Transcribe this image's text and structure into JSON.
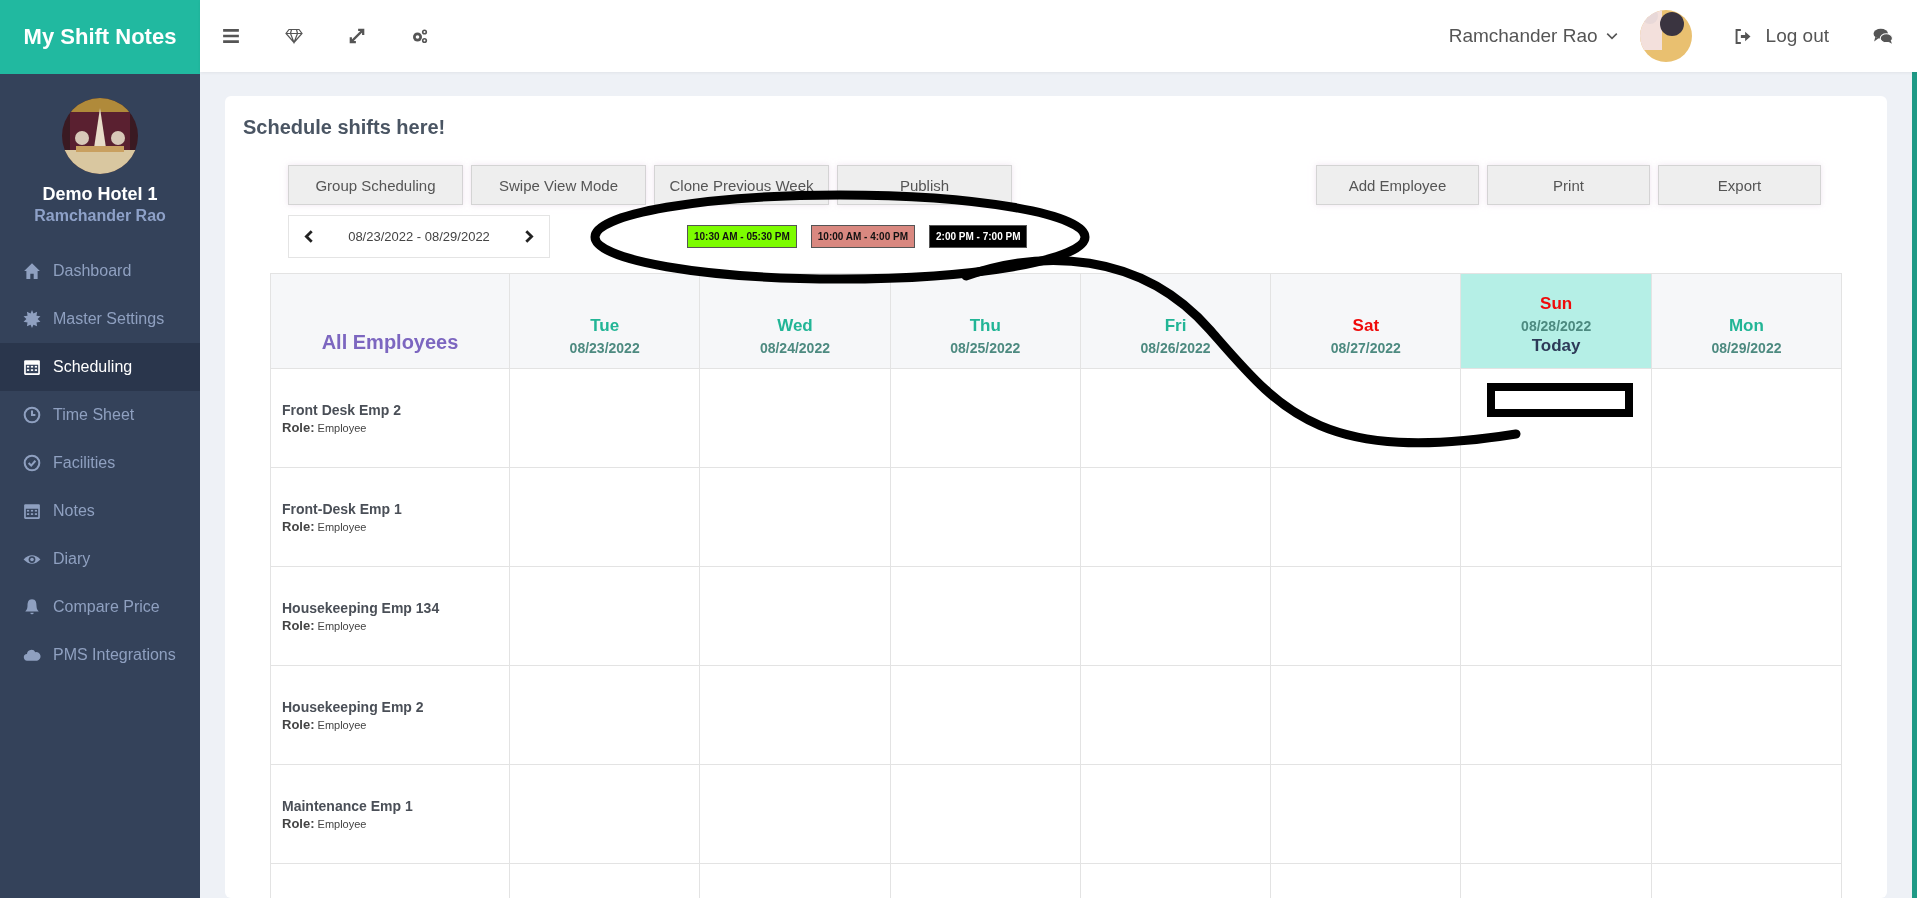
{
  "brand": "My Shift Notes",
  "topbar": {
    "user_name": "Ramchander Rao",
    "logout": "Log out"
  },
  "sidebar": {
    "hotel": "Demo Hotel 1",
    "user": "Ramchander Rao",
    "items": [
      {
        "label": "Dashboard",
        "kind": "home",
        "selected": false
      },
      {
        "label": "Master Settings",
        "kind": "burst",
        "selected": false
      },
      {
        "label": "Scheduling",
        "kind": "calendar",
        "selected": true
      },
      {
        "label": "Time Sheet",
        "kind": "clock",
        "selected": false
      },
      {
        "label": "Facilities",
        "kind": "check",
        "selected": false
      },
      {
        "label": "Notes",
        "kind": "calendar",
        "selected": false
      },
      {
        "label": "Diary",
        "kind": "eye",
        "selected": false
      },
      {
        "label": "Compare Price",
        "kind": "bell",
        "selected": false
      },
      {
        "label": "PMS Integrations",
        "kind": "cloud",
        "selected": false
      }
    ]
  },
  "page_title": "Schedule shifts here!",
  "left_buttons": [
    "Group Scheduling",
    "Swipe View Mode",
    "Clone Previous Week",
    "Publish"
  ],
  "right_buttons": [
    "Add Employee",
    "Print",
    "Export"
  ],
  "date_range": "08/23/2022 - 08/29/2022",
  "shift_legend": [
    {
      "label": "10:30 AM - 05:30 PM",
      "color": "#7cfc00"
    },
    {
      "label": "10:00 AM - 4:00 PM",
      "color": "#d98880"
    },
    {
      "label": "2:00 PM - 7:00 PM",
      "color": "#000000"
    }
  ],
  "table": {
    "corner": "All Employees",
    "days": [
      {
        "day": "Tue",
        "date": "08/23/2022",
        "weekend": false,
        "today": false
      },
      {
        "day": "Wed",
        "date": "08/24/2022",
        "weekend": false,
        "today": false
      },
      {
        "day": "Thu",
        "date": "08/25/2022",
        "weekend": false,
        "today": false
      },
      {
        "day": "Fri",
        "date": "08/26/2022",
        "weekend": false,
        "today": false
      },
      {
        "day": "Sat",
        "date": "08/27/2022",
        "weekend": true,
        "today": false
      },
      {
        "day": "Sun",
        "date": "08/28/2022",
        "weekend": true,
        "today": true,
        "today_label": "Today"
      },
      {
        "day": "Mon",
        "date": "08/29/2022",
        "weekend": false,
        "today": false
      }
    ],
    "rows": [
      {
        "name": "Front Desk Emp 2",
        "role_label": "Role:",
        "role": "Employee"
      },
      {
        "name": "Front-Desk Emp 1",
        "role_label": "Role:",
        "role": "Employee"
      },
      {
        "name": "Housekeeping Emp 134",
        "role_label": "Role:",
        "role": "Employee"
      },
      {
        "name": "Housekeeping Emp 2",
        "role_label": "Role:",
        "role": "Employee"
      },
      {
        "name": "Maintenance Emp 1",
        "role_label": "Role:",
        "role": "Employee"
      }
    ]
  }
}
